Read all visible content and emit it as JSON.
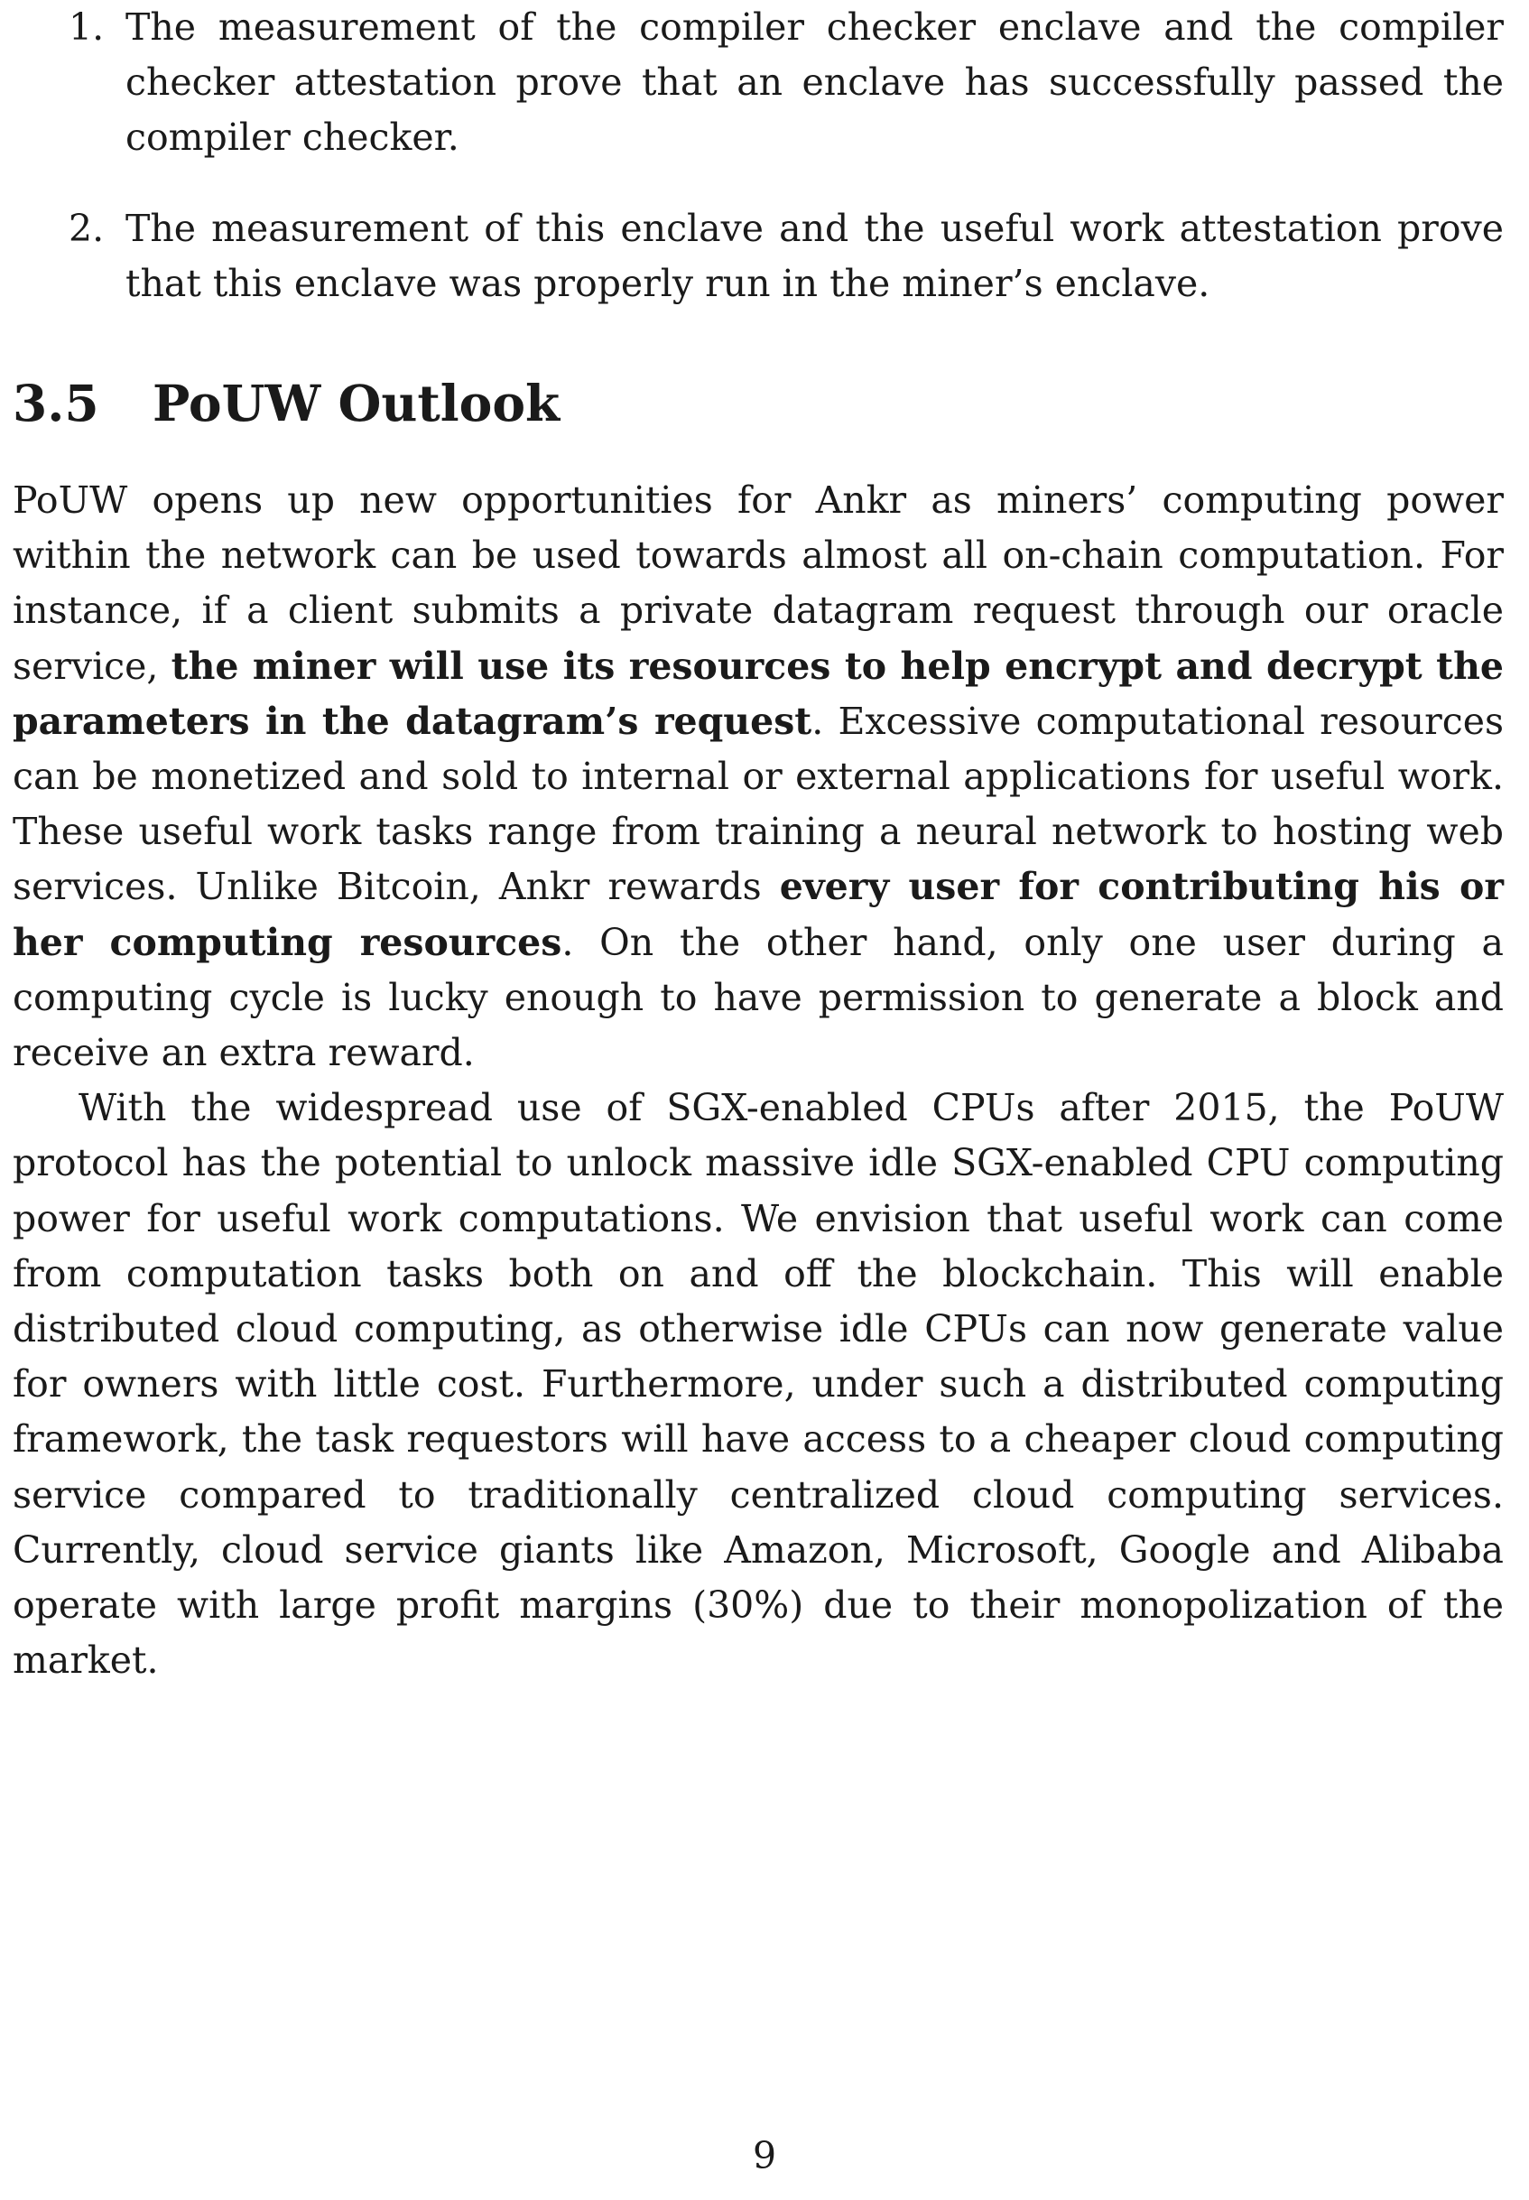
{
  "list": [
    {
      "marker": "1.",
      "text": "The measurement of the compiler checker enclave and the compiler checker attestation prove that an enclave has successfully passed the compiler checker."
    },
    {
      "marker": "2.",
      "text": "The measurement of this enclave and the useful work attestation prove that this enclave was properly run in the miner’s enclave."
    }
  ],
  "section": {
    "number": "3.5",
    "title": "PoUW Outlook"
  },
  "paragraph1": {
    "part1": "PoUW opens up new opportunities for Ankr as miners’ computing power within the network can be used towards almost all on-chain computation. For instance, if a client submits a private datagram request through our oracle service, ",
    "bold1": "the miner will use its resources to help encrypt and decrypt the parameters in the datagram’s request",
    "part2": ". Excessive computational resources can be monetized and sold to internal or external applications for useful work. These useful work tasks range from training a neural network to hosting web services. Unlike Bitcoin, Ankr rewards ",
    "bold2": "every user for contributing his or her computing resources",
    "part3": ". On the other hand, only one user during a computing cycle is lucky enough to have permission to generate a block and receive an extra reward."
  },
  "paragraph2": "With the widespread use of SGX-enabled CPUs after 2015, the PoUW protocol has the potential to unlock massive idle SGX-enabled CPU computing power for useful work computations. We envision that useful work can come from computation tasks both on and off the blockchain. This will enable distributed cloud computing, as otherwise idle CPUs can now generate value for owners with little cost. Furthermore, under such a distributed computing framework, the task requestors will have access to a cheaper cloud computing service compared to traditionally centralized cloud computing services. Currently, cloud service giants like Amazon, Microsoft, Google and Alibaba operate with large profit margins (30%) due to their monopolization of the market.",
  "page_number": "9"
}
